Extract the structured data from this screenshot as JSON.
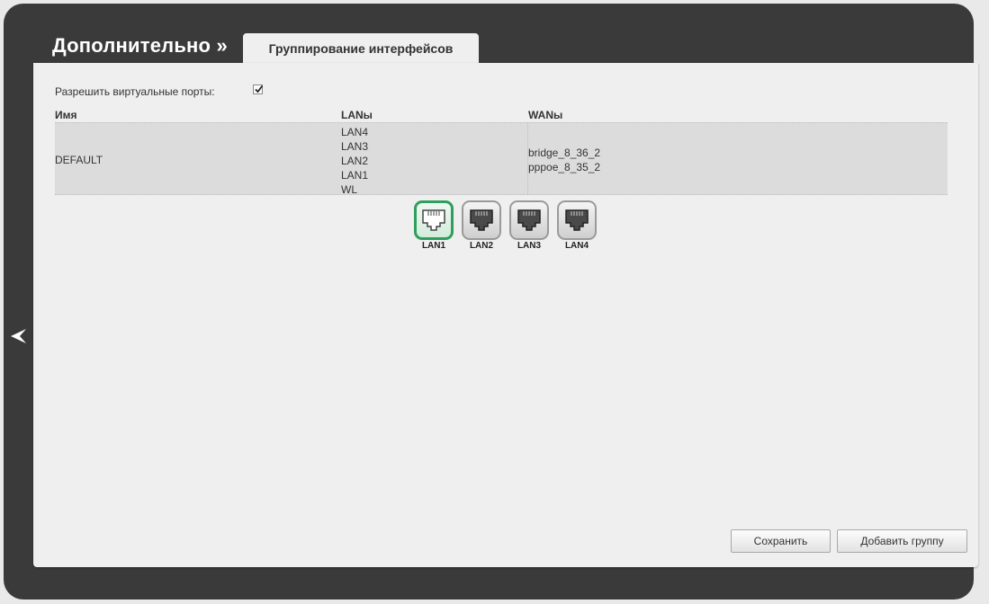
{
  "header": {
    "section_title": "Дополнительно »",
    "active_tab": "Группирование интерфейсов"
  },
  "options": {
    "virtual_ports_label": "Разрешить виртуальные порты:",
    "virtual_ports_checked": true
  },
  "table": {
    "columns": [
      "Имя",
      "LANы",
      "WANы"
    ],
    "rows": [
      {
        "name": "DEFAULT",
        "lans": [
          "LAN4",
          "LAN3",
          "LAN2",
          "LAN1",
          "WL"
        ],
        "wans": [
          "bridge_8_36_2",
          "pppoe_8_35_2"
        ]
      }
    ]
  },
  "ports": [
    {
      "label": "LAN1",
      "active": true
    },
    {
      "label": "LAN2",
      "active": false
    },
    {
      "label": "LAN3",
      "active": false
    },
    {
      "label": "LAN4",
      "active": false
    }
  ],
  "buttons": {
    "save": "Сохранить",
    "add_group": "Добавить группу"
  },
  "icons": {
    "back": "back-arrow-icon",
    "port": "ethernet-port-icon",
    "check": "checkmark-icon"
  },
  "colors": {
    "frame": "#3a3a3a",
    "panel": "#efefef",
    "active_port_border": "#2e9f5d",
    "row_bg": "#dcdcdc"
  }
}
